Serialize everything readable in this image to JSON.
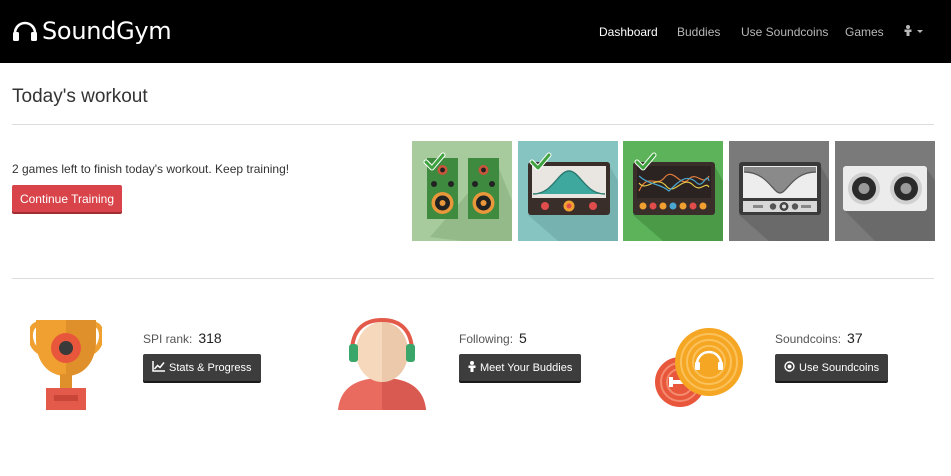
{
  "brand": {
    "name": "SoundGym",
    "logo_icon": "headphones-icon"
  },
  "nav": {
    "items": [
      {
        "label": "Dashboard",
        "active": true
      },
      {
        "label": "Buddies",
        "active": false
      },
      {
        "label": "Use Soundcoins",
        "active": false
      },
      {
        "label": "Games",
        "active": false
      }
    ],
    "user_menu_icon": "user-icon"
  },
  "workout": {
    "title": "Today's workout",
    "message": "2 games left to finish today's workout. Keep training!",
    "continue_label": "Continue Training",
    "games": [
      {
        "icon": "speakers-icon",
        "completed": true
      },
      {
        "icon": "eq-curve-icon",
        "completed": true
      },
      {
        "icon": "spectrum-analyzer-icon",
        "completed": true
      },
      {
        "icon": "filter-curve-icon",
        "completed": false
      },
      {
        "icon": "stereo-speaker-icon",
        "completed": false
      }
    ]
  },
  "stats": {
    "spi": {
      "label": "SPI rank:",
      "value": "318",
      "button": "Stats & Progress",
      "button_icon": "chart-icon",
      "icon": "trophy-icon"
    },
    "following": {
      "label": "Following:",
      "value": "5",
      "button": "Meet Your Buddies",
      "button_icon": "user-icon",
      "icon": "avatar-headphones-icon"
    },
    "soundcoins": {
      "label": "Soundcoins:",
      "value": "37",
      "button": "Use Soundcoins",
      "button_icon": "coin-icon",
      "icon": "soundcoins-icon"
    }
  },
  "colors": {
    "accent_red": "#d9434a",
    "dark_button": "#3d3d3d",
    "navbar": "#000000"
  }
}
